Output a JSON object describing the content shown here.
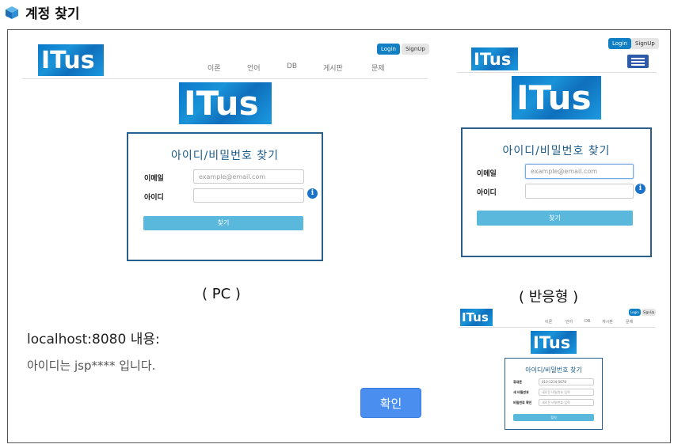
{
  "heading": {
    "title": "계정 찾기"
  },
  "pc": {
    "brand": "ITus",
    "login_label": "Login",
    "signup_label": "SignUp",
    "nav": [
      "이론",
      "언어",
      "DB",
      "게시판",
      "문제"
    ],
    "card_title": "아이디/비밀번호 찾기",
    "email_label": "이메일",
    "email_placeholder": "example@email.com",
    "id_label": "아이디",
    "submit_label": "찾기",
    "caption": "( PC )"
  },
  "responsive": {
    "brand": "ITus",
    "login_label": "Login",
    "signup_label": "SignUp",
    "card_title": "아이디/비밀번호 찾기",
    "email_label": "이메일",
    "email_placeholder": "example@email.com",
    "id_label": "아이디",
    "submit_label": "찾기",
    "caption": "( 반응형 )"
  },
  "alert": {
    "host": "localhost:8080 내용:",
    "message": "아이디는 jsp**** 입니다.",
    "ok_label": "확인"
  },
  "reset": {
    "brand": "ITus",
    "login_label": "Login",
    "signup_label": "SignUp",
    "nav": [
      "이론",
      "언어",
      "DB",
      "게시판",
      "문제"
    ],
    "card_title": "아이디/비밀번호 찾기",
    "phone_label": "휴대폰",
    "phone_value": "010-1234-5678",
    "new_pw_label": "새 비밀번호",
    "new_pw_placeholder": "새로운 비밀번호 입력",
    "confirm_pw_label": "비밀번호 확인",
    "confirm_pw_placeholder": "새로운 비밀번호 입력",
    "submit_label": "찾기"
  }
}
